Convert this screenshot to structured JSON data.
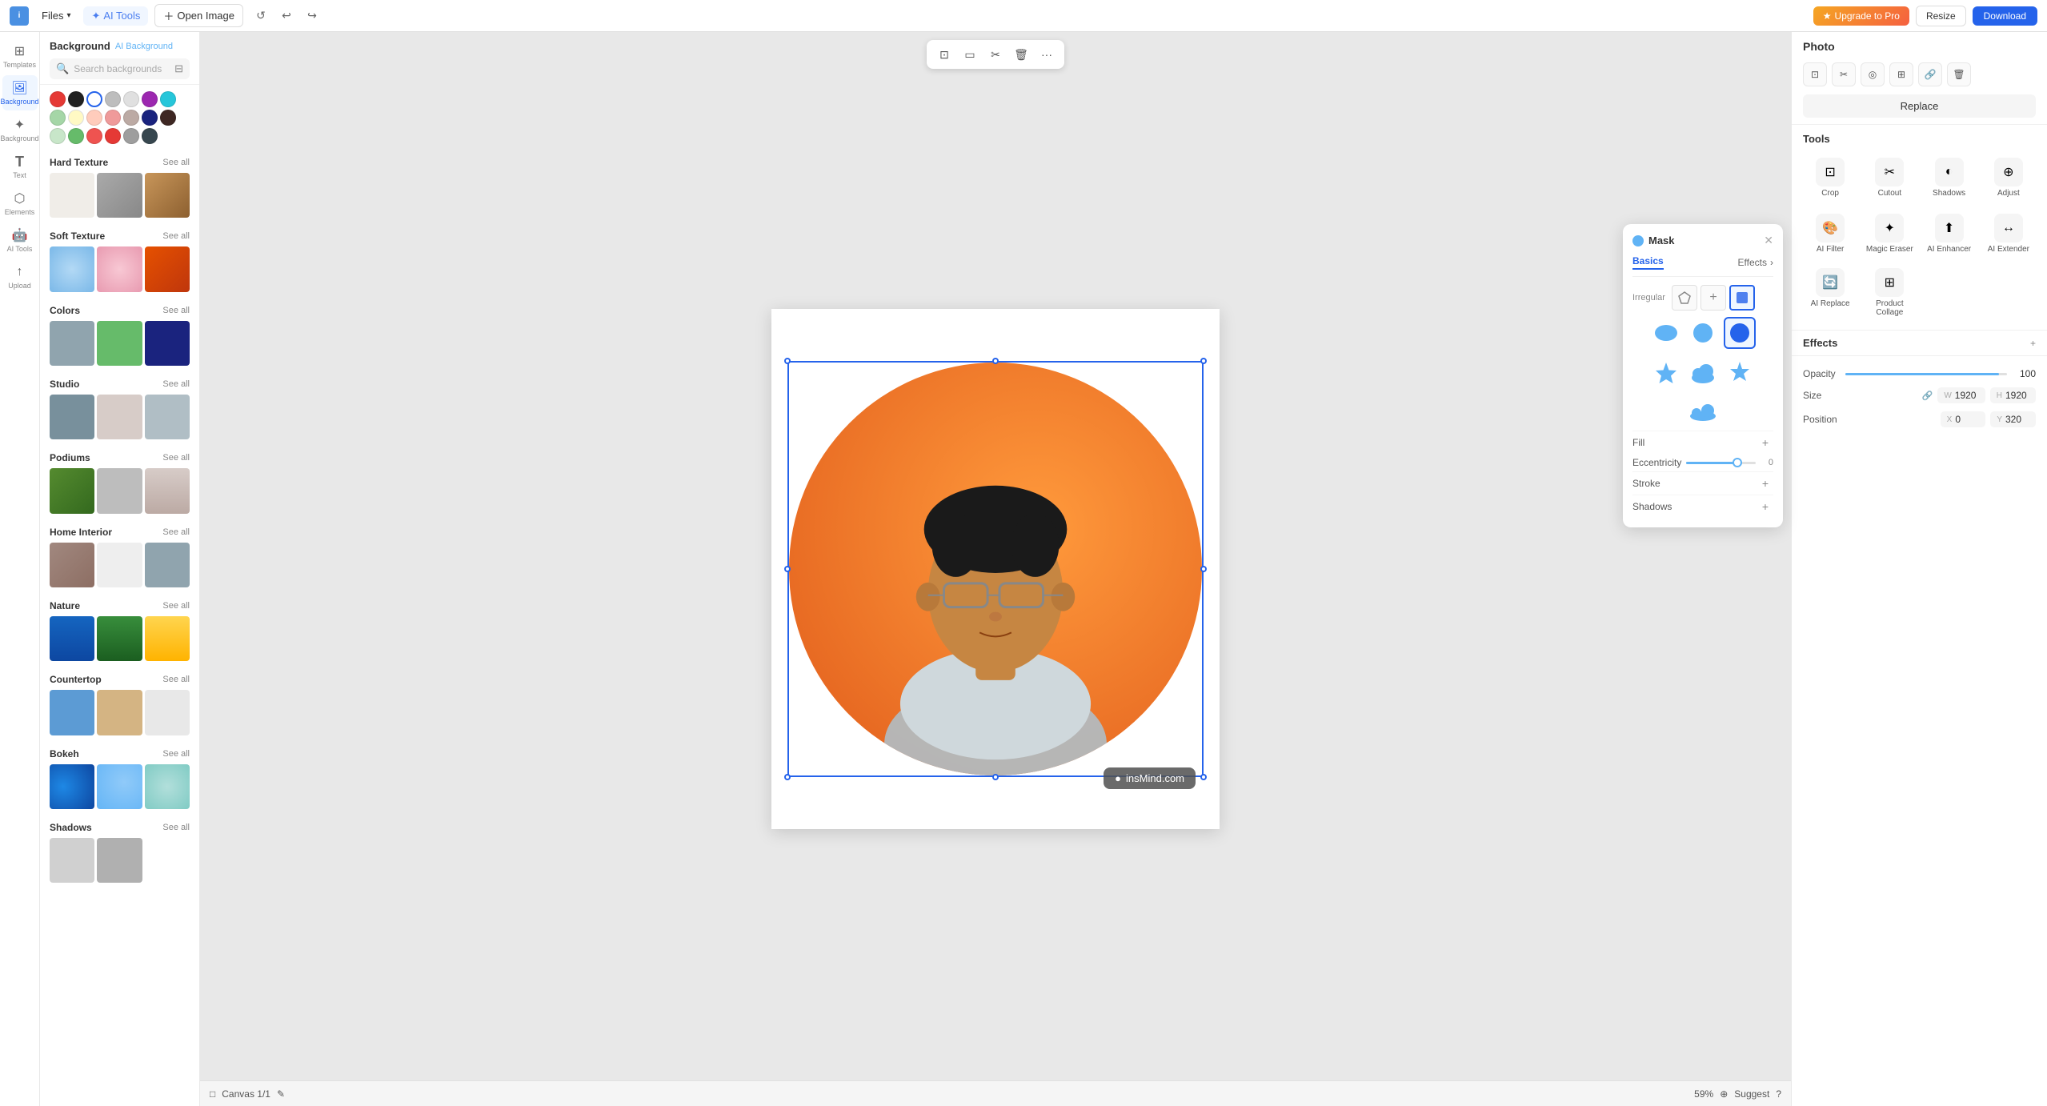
{
  "topbar": {
    "logo": "i",
    "files_label": "Files",
    "ai_tools_label": "AI Tools",
    "open_image_label": "Open Image",
    "upgrade_label": "Upgrade to Pro",
    "resize_label": "Resize",
    "download_label": "Download"
  },
  "left_sidebar": {
    "items": [
      {
        "id": "templates",
        "label": "Templates",
        "icon": "⊞"
      },
      {
        "id": "background",
        "label": "Background",
        "icon": "🖼"
      },
      {
        "id": "ai-background",
        "label": "AI Background",
        "icon": "✨"
      },
      {
        "id": "text",
        "label": "Text",
        "icon": "T"
      },
      {
        "id": "elements",
        "label": "Elements",
        "icon": "⬡"
      },
      {
        "id": "ai-tools",
        "label": "AI Tools",
        "icon": "🤖"
      },
      {
        "id": "upload",
        "label": "Upload",
        "icon": "↑"
      }
    ]
  },
  "bg_panel": {
    "title": "Background",
    "subtitle": "AI Background",
    "search_placeholder": "Search backgrounds",
    "filter_icon": "filter",
    "color_swatches": [
      {
        "color": "#e53935",
        "selected": false
      },
      {
        "color": "#212121",
        "selected": false
      },
      {
        "color": "#ffffff",
        "selected": true
      },
      {
        "color": "#bdbdbd",
        "selected": false
      },
      {
        "color": "#e0e0e0",
        "selected": false
      },
      {
        "color": "#9c27b0",
        "selected": false
      },
      {
        "color": "#26c6da",
        "selected": false
      },
      {
        "color": "#a5d6a7",
        "selected": false
      },
      {
        "color": "#fff9c4",
        "selected": false
      },
      {
        "color": "#ffccbc",
        "selected": false
      },
      {
        "color": "#ef9a9a",
        "selected": false
      },
      {
        "color": "#bcaaa4",
        "selected": false
      },
      {
        "color": "#1a237e",
        "selected": false
      },
      {
        "color": "#3e2723",
        "selected": false
      },
      {
        "color": "#c8e6c9",
        "selected": false
      },
      {
        "color": "#66bb6a",
        "selected": false
      },
      {
        "color": "#ef5350",
        "selected": false
      },
      {
        "color": "#e53935",
        "selected": false
      },
      {
        "color": "#9e9e9e",
        "selected": false
      },
      {
        "color": "#37474f",
        "selected": false
      }
    ],
    "sections": [
      {
        "id": "hard-texture",
        "title": "Hard Texture",
        "see_all": "See all",
        "thumbs": [
          {
            "bg": "#f5f5f5"
          },
          {
            "bg": "#9e9e9e"
          },
          {
            "bg": "#8d6e63"
          }
        ]
      },
      {
        "id": "soft-texture",
        "title": "Soft Texture",
        "see_all": "See all",
        "thumbs": [
          {
            "bg": "#90caf9"
          },
          {
            "bg": "#f48fb1"
          },
          {
            "bg": "#e65100"
          }
        ]
      },
      {
        "id": "colors",
        "title": "Colors",
        "see_all": "See all",
        "thumbs": [
          {
            "bg": "#90a4ae"
          },
          {
            "bg": "#66bb6a"
          },
          {
            "bg": "#1a237e"
          }
        ]
      },
      {
        "id": "studio",
        "title": "Studio",
        "see_all": "See all",
        "thumbs": [
          {
            "bg": "#78909c"
          },
          {
            "bg": "#bcaaa4"
          },
          {
            "bg": "#b0bec5"
          }
        ]
      },
      {
        "id": "podiums",
        "title": "Podiums",
        "see_all": "See all",
        "thumbs": [
          {
            "bg": "#558b2f"
          },
          {
            "bg": "#bdbdbd"
          },
          {
            "bg": "#d7ccc8"
          }
        ]
      },
      {
        "id": "home-interior",
        "title": "Home Interior",
        "see_all": "See all",
        "thumbs": [
          {
            "bg": "#a1887f"
          },
          {
            "bg": "#d7ccc8"
          },
          {
            "bg": "#90a4ae"
          }
        ]
      },
      {
        "id": "nature",
        "title": "Nature",
        "see_all": "See all",
        "thumbs": [
          {
            "bg": "#1565c0"
          },
          {
            "bg": "#388e3c"
          },
          {
            "bg": "#ffd54f"
          }
        ]
      },
      {
        "id": "countertop",
        "title": "Countertop",
        "see_all": "See all",
        "thumbs": [
          {
            "bg": "#5c9bd4"
          },
          {
            "bg": "#d4b483"
          },
          {
            "bg": "#e8e8e8"
          }
        ]
      },
      {
        "id": "bokeh",
        "title": "Bokeh",
        "see_all": "See all",
        "thumbs": [
          {
            "bg": "#1565c0"
          },
          {
            "bg": "#90caf9"
          },
          {
            "bg": "#b2dfdb"
          }
        ]
      },
      {
        "id": "shadows",
        "title": "Shadows",
        "see_all": "See all",
        "thumbs": [
          {
            "bg": "#bdbdbd"
          },
          {
            "bg": "#9e9e9e"
          }
        ]
      }
    ]
  },
  "canvas": {
    "toolbar_tools": [
      "crop-icon",
      "rectangle-icon",
      "scissors-icon",
      "trash-icon",
      "more-icon"
    ],
    "canvas_label": "Canvas 1/1",
    "zoom_level": "59%",
    "suggest_label": "Suggest",
    "watermark": "insMind.com"
  },
  "right_panel": {
    "photo_title": "Photo",
    "replace_label": "Replace",
    "tools_title": "Tools",
    "tools": [
      {
        "id": "crop",
        "label": "Crop",
        "icon": "⊡"
      },
      {
        "id": "cutout",
        "label": "Cutout",
        "icon": "✂"
      },
      {
        "id": "shadows",
        "label": "Shadows",
        "icon": "◐"
      },
      {
        "id": "adjust",
        "label": "Adjust",
        "icon": "⊕"
      },
      {
        "id": "ai-filter",
        "label": "AI Filter",
        "icon": "🎨"
      },
      {
        "id": "magic-eraser",
        "label": "Magic Eraser",
        "icon": "✦"
      },
      {
        "id": "ai-enhancer",
        "label": "AI Enhancer",
        "icon": "⬆"
      },
      {
        "id": "ai-extender",
        "label": "AI Extender",
        "icon": "↔"
      },
      {
        "id": "ai-replace",
        "label": "AI Replace",
        "icon": "🔄"
      },
      {
        "id": "product-collage",
        "label": "Product Collage",
        "icon": "⊞"
      }
    ],
    "effects_label": "Effects",
    "opacity_label": "Opacity",
    "opacity_value": "100",
    "size_label": "Size",
    "size_w": "1920",
    "size_h": "1920",
    "position_label": "Position",
    "position_x": "0",
    "position_y": "320"
  },
  "mask_panel": {
    "title": "Mask",
    "basics_label": "Basics",
    "effects_label": "Effects",
    "irregular_label": "Irregular",
    "fill_label": "Fill",
    "stroke_label": "Stroke",
    "shadows_label": "Shadows",
    "eccentricity_label": "Eccentricity",
    "eccentricity_value": "0",
    "shapes": [
      "pentagon",
      "cloud",
      "star6"
    ],
    "circles": [
      "oval-h",
      "circle",
      "circle-selected"
    ],
    "extra_shapes": [
      "star5",
      "cloud2",
      "star4",
      "cloud3"
    ]
  }
}
